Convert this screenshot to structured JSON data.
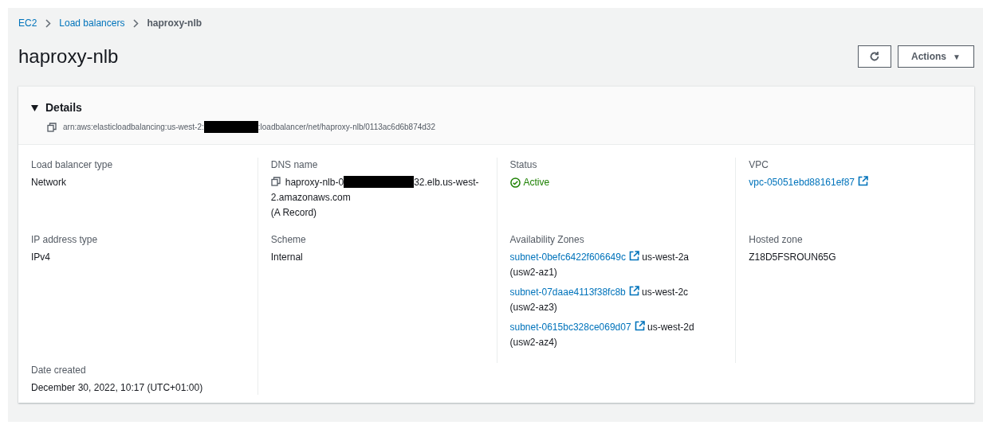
{
  "breadcrumbs": [
    {
      "label": "EC2",
      "kind": "link"
    },
    {
      "label": "Load balancers",
      "kind": "link"
    },
    {
      "label": "haproxy-nlb",
      "kind": "current"
    }
  ],
  "title": "haproxy-nlb",
  "actions": {
    "label": "Actions",
    "caret": "▼"
  },
  "details": {
    "title": "Details",
    "expanded": true,
    "arn_prefix": "arn:aws:elasticloadbalancing:us-west-2:",
    "arn_suffix": ":loadbalancer/net/haproxy-nlb/0113ac6d6b874d32",
    "fields": [
      {
        "kind": "text",
        "label": "Load balancer type",
        "value": "Network"
      },
      {
        "kind": "dns",
        "label": "DNS name",
        "prefix": "haproxy-nlb-0",
        "suffix": "32.elb.us-west-2.amazonaws.com",
        "note": "(A Record)"
      },
      {
        "kind": "status",
        "label": "Status",
        "value": "Active"
      },
      {
        "kind": "link",
        "label": "VPC",
        "value": "vpc-05051ebd88161ef87"
      },
      {
        "kind": "text",
        "label": "IP address type",
        "value": "IPv4"
      },
      {
        "kind": "text",
        "label": "Scheme",
        "value": "Internal"
      },
      {
        "kind": "zones",
        "label": "Availability Zones",
        "zones": [
          {
            "subnet": "subnet-0befc6422f606649c",
            "zone": "us-west-2a (usw2-az1)"
          },
          {
            "subnet": "subnet-07daae4113f38fc8b",
            "zone": "us-west-2c (usw2-az3)"
          },
          {
            "subnet": "subnet-0615bc328ce069d07",
            "zone": "us-west-2d (usw2-az4)"
          }
        ]
      },
      {
        "kind": "text",
        "label": "Hosted zone",
        "value": "Z18D5FSROUN65G"
      },
      {
        "kind": "text",
        "label": "Date created",
        "value": "December 30, 2022, 10:17 (UTC+01:00)"
      }
    ]
  }
}
